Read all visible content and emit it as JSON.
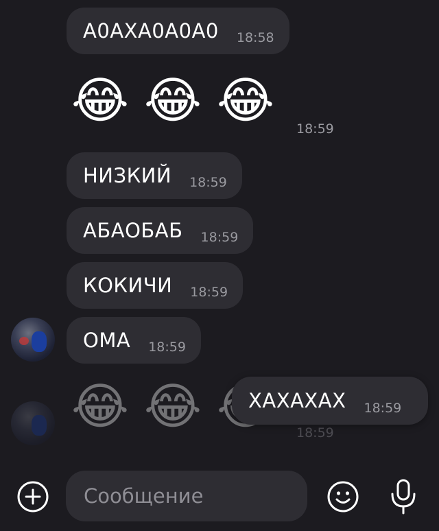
{
  "messages": [
    {
      "text": "А0АХА0А0А0",
      "time": "18:58"
    },
    {
      "emoji": [
        "😂",
        "😂",
        "😂"
      ],
      "time": "18:59"
    },
    {
      "text": "НИЗКИЙ",
      "time": "18:59"
    },
    {
      "text": "АБАОБАБ",
      "time": "18:59"
    },
    {
      "text": "КОКИЧИ",
      "time": "18:59"
    },
    {
      "text": "ОМА",
      "time": "18:59"
    },
    {
      "emoji": [
        "😂",
        "😂",
        "😂"
      ],
      "time": "18:59"
    }
  ],
  "context_preview": {
    "text": "ХАХАХАХ",
    "time": "18:59"
  },
  "composer": {
    "placeholder": "Сообщение",
    "icons": [
      "add-icon",
      "emoji-icon",
      "microphone-icon"
    ]
  },
  "colors": {
    "background": "#1c1b20",
    "bubble": "#2e2d33",
    "text": "#ffffff",
    "timestamp": "#9a9aa0"
  }
}
